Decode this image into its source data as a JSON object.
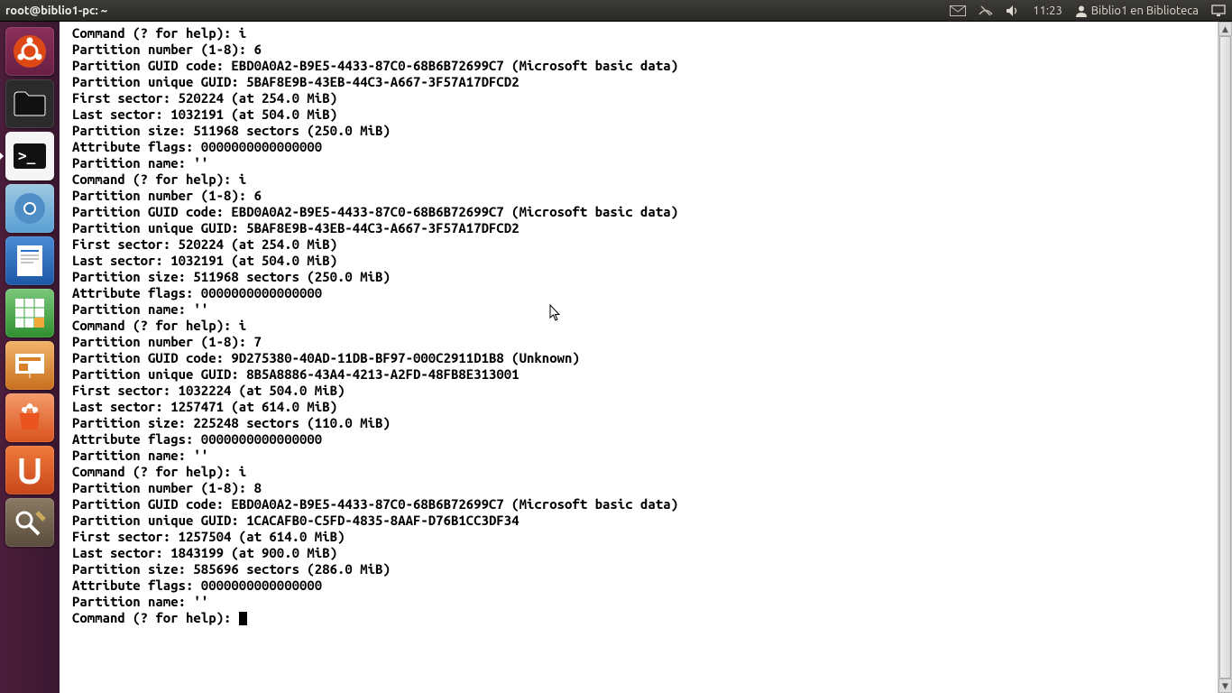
{
  "topbar": {
    "title": "root@biblio1-pc: ~",
    "time": "11:23",
    "user_label": "Biblio1 en Biblioteca"
  },
  "launcher": {
    "items": [
      {
        "name": "dash-home",
        "color": "#dd4814"
      },
      {
        "name": "files",
        "color": "#2e2e2e"
      },
      {
        "name": "terminal",
        "color": "#ffffff"
      },
      {
        "name": "chromium",
        "color": "#5a9fd4"
      },
      {
        "name": "writer",
        "color": "#2a6fc9"
      },
      {
        "name": "calc",
        "color": "#3aa53a"
      },
      {
        "name": "impress",
        "color": "#d9822b"
      },
      {
        "name": "software-center",
        "color": "#e95420"
      },
      {
        "name": "ubuntu-one",
        "color": "#e95420"
      },
      {
        "name": "system-settings",
        "color": "#6a5b4a"
      }
    ]
  },
  "terminal": {
    "lines": [
      "Command (? for help): i",
      "Partition number (1-8): 6",
      "Partition GUID code: EBD0A0A2-B9E5-4433-87C0-68B6B72699C7 (Microsoft basic data)",
      "Partition unique GUID: 5BAF8E9B-43EB-44C3-A667-3F57A17DFCD2",
      "First sector: 520224 (at 254.0 MiB)",
      "Last sector: 1032191 (at 504.0 MiB)",
      "Partition size: 511968 sectors (250.0 MiB)",
      "Attribute flags: 0000000000000000",
      "Partition name: ''",
      "",
      "Command (? for help): i",
      "Partition number (1-8): 6",
      "Partition GUID code: EBD0A0A2-B9E5-4433-87C0-68B6B72699C7 (Microsoft basic data)",
      "Partition unique GUID: 5BAF8E9B-43EB-44C3-A667-3F57A17DFCD2",
      "First sector: 520224 (at 254.0 MiB)",
      "Last sector: 1032191 (at 504.0 MiB)",
      "Partition size: 511968 sectors (250.0 MiB)",
      "Attribute flags: 0000000000000000",
      "Partition name: ''",
      "",
      "Command (? for help): i",
      "Partition number (1-8): 7",
      "Partition GUID code: 9D275380-40AD-11DB-BF97-000C2911D1B8 (Unknown)",
      "Partition unique GUID: 8B5A8886-43A4-4213-A2FD-48FB8E313001",
      "First sector: 1032224 (at 504.0 MiB)",
      "Last sector: 1257471 (at 614.0 MiB)",
      "Partition size: 225248 sectors (110.0 MiB)",
      "Attribute flags: 0000000000000000",
      "Partition name: ''",
      "",
      "Command (? for help): i",
      "Partition number (1-8): 8",
      "Partition GUID code: EBD0A0A2-B9E5-4433-87C0-68B6B72699C7 (Microsoft basic data)",
      "Partition unique GUID: 1CACAFB0-C5FD-4835-8AAF-D76B1CC3DF34",
      "First sector: 1257504 (at 614.0 MiB)",
      "Last sector: 1843199 (at 900.0 MiB)",
      "Partition size: 585696 sectors (286.0 MiB)",
      "Attribute flags: 0000000000000000",
      "Partition name: ''",
      "",
      "Command (? for help): "
    ]
  }
}
